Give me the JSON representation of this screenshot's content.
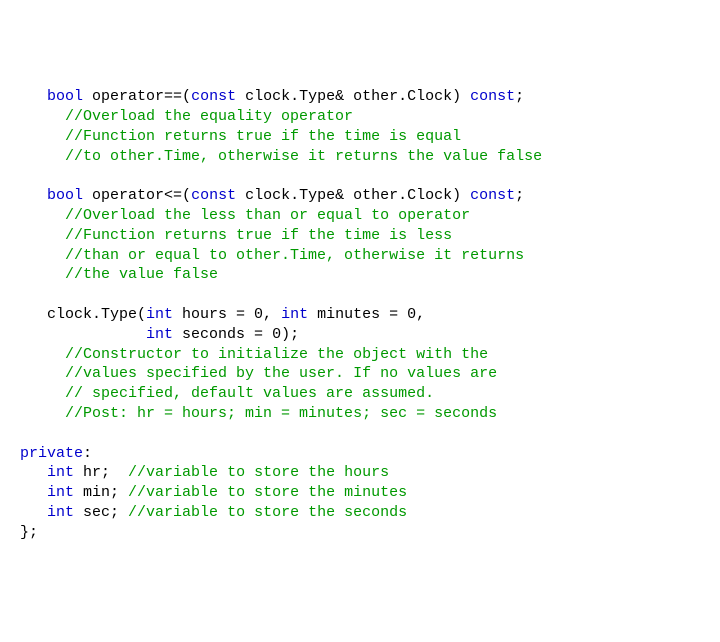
{
  "lines": [
    {
      "indent": "   ",
      "segs": [
        {
          "c": "kw",
          "t": "bool"
        },
        {
          "c": "",
          "t": " operator==("
        },
        {
          "c": "kw",
          "t": "const"
        },
        {
          "c": "",
          "t": " clock.Type& other.Clock) "
        },
        {
          "c": "kw",
          "t": "const"
        },
        {
          "c": "",
          "t": ";"
        }
      ]
    },
    {
      "indent": "     ",
      "segs": [
        {
          "c": "cm",
          "t": "//Overload the equality operator"
        }
      ]
    },
    {
      "indent": "     ",
      "segs": [
        {
          "c": "cm",
          "t": "//Function returns true if the time is equal"
        }
      ]
    },
    {
      "indent": "     ",
      "segs": [
        {
          "c": "cm",
          "t": "//to other.Time, otherwise it returns the value false"
        }
      ]
    },
    {
      "indent": "",
      "segs": []
    },
    {
      "indent": "   ",
      "segs": [
        {
          "c": "kw",
          "t": "bool"
        },
        {
          "c": "",
          "t": " operator<=("
        },
        {
          "c": "kw",
          "t": "const"
        },
        {
          "c": "",
          "t": " clock.Type& other.Clock) "
        },
        {
          "c": "kw",
          "t": "const"
        },
        {
          "c": "",
          "t": ";"
        }
      ]
    },
    {
      "indent": "     ",
      "segs": [
        {
          "c": "cm",
          "t": "//Overload the less than or equal to operator"
        }
      ]
    },
    {
      "indent": "     ",
      "segs": [
        {
          "c": "cm",
          "t": "//Function returns true if the time is less"
        }
      ]
    },
    {
      "indent": "     ",
      "segs": [
        {
          "c": "cm",
          "t": "//than or equal to other.Time, otherwise it returns"
        }
      ]
    },
    {
      "indent": "     ",
      "segs": [
        {
          "c": "cm",
          "t": "//the value false"
        }
      ]
    },
    {
      "indent": "",
      "segs": []
    },
    {
      "indent": "   ",
      "segs": [
        {
          "c": "",
          "t": "clock.Type("
        },
        {
          "c": "kw",
          "t": "int"
        },
        {
          "c": "",
          "t": " hours = 0, "
        },
        {
          "c": "kw",
          "t": "int"
        },
        {
          "c": "",
          "t": " minutes = 0,"
        }
      ]
    },
    {
      "indent": "              ",
      "segs": [
        {
          "c": "kw",
          "t": "int"
        },
        {
          "c": "",
          "t": " seconds = 0);"
        }
      ]
    },
    {
      "indent": "     ",
      "segs": [
        {
          "c": "cm",
          "t": "//Constructor to initialize the object with the"
        }
      ]
    },
    {
      "indent": "     ",
      "segs": [
        {
          "c": "cm",
          "t": "//values specified by the user. If no values are"
        }
      ]
    },
    {
      "indent": "     ",
      "segs": [
        {
          "c": "cm",
          "t": "// specified, default values are assumed."
        }
      ]
    },
    {
      "indent": "     ",
      "segs": [
        {
          "c": "cm",
          "t": "//Post: hr = hours; min = minutes; sec = seconds"
        }
      ]
    },
    {
      "indent": "",
      "segs": []
    },
    {
      "indent": "",
      "segs": [
        {
          "c": "kw",
          "t": "private"
        },
        {
          "c": "",
          "t": ":"
        }
      ]
    },
    {
      "indent": "   ",
      "segs": [
        {
          "c": "kw",
          "t": "int"
        },
        {
          "c": "",
          "t": " hr;  "
        },
        {
          "c": "cm",
          "t": "//variable to store the hours"
        }
      ]
    },
    {
      "indent": "   ",
      "segs": [
        {
          "c": "kw",
          "t": "int"
        },
        {
          "c": "",
          "t": " min; "
        },
        {
          "c": "cm",
          "t": "//variable to store the minutes"
        }
      ]
    },
    {
      "indent": "   ",
      "segs": [
        {
          "c": "kw",
          "t": "int"
        },
        {
          "c": "",
          "t": " sec; "
        },
        {
          "c": "cm",
          "t": "//variable to store the seconds"
        }
      ]
    },
    {
      "indent": "",
      "segs": [
        {
          "c": "",
          "t": "};"
        }
      ]
    }
  ]
}
